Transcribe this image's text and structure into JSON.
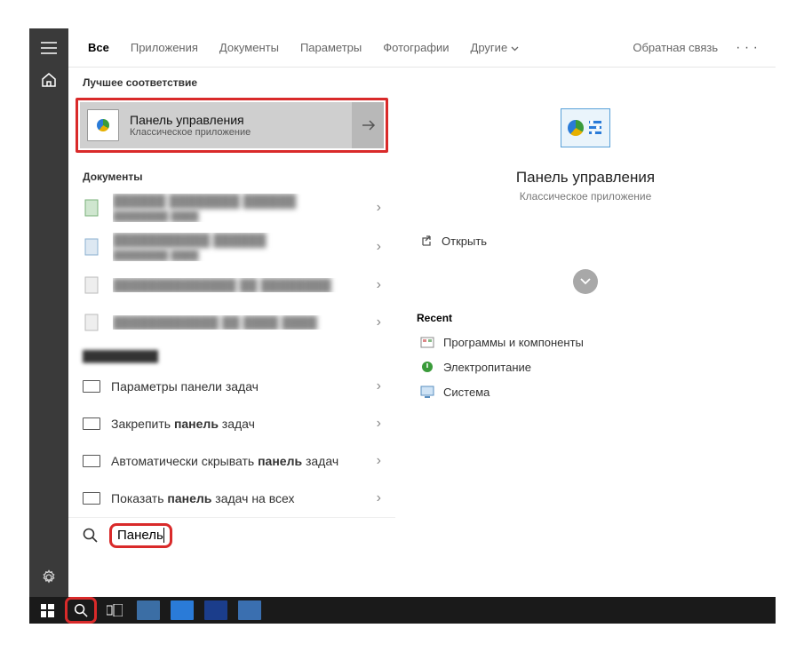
{
  "tabs": {
    "all": "Все",
    "apps": "Приложения",
    "docs": "Документы",
    "settings": "Параметры",
    "photos": "Фотографии",
    "more": "Другие"
  },
  "feedback": "Обратная связь",
  "sections": {
    "best_match": "Лучшее соответствие",
    "documents": "Документы",
    "recent": "Recent"
  },
  "best_match": {
    "title": "Панель управления",
    "subtitle": "Классическое приложение"
  },
  "settings_results": [
    "Параметры панели задач",
    "Закрепить <b>панель</b> задач",
    "Автоматически скрывать <b>панель</b> задач",
    "Показать <b>панель</b> задач на всех"
  ],
  "search_value": "Панель",
  "preview": {
    "title": "Панель управления",
    "subtitle": "Классическое приложение",
    "open": "Открыть"
  },
  "recent_items": [
    {
      "icon": "programs",
      "label": "Программы и компоненты"
    },
    {
      "icon": "power",
      "label": "Электропитание"
    },
    {
      "icon": "system",
      "label": "Система"
    }
  ]
}
